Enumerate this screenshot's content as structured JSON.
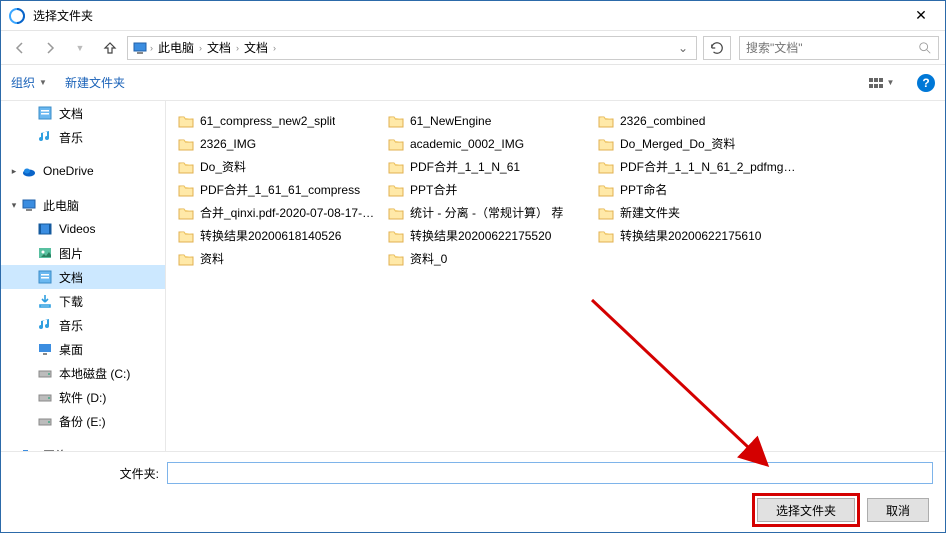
{
  "title": "选择文件夹",
  "breadcrumb": [
    "此电脑",
    "文档",
    "文档"
  ],
  "search_placeholder": "搜索\"文档\"",
  "toolbar": {
    "organize": "组织",
    "new_folder": "新建文件夹"
  },
  "tree": [
    {
      "label": "文档",
      "icon": "doc-lib",
      "indent": 1,
      "caret": ""
    },
    {
      "label": "音乐",
      "icon": "music",
      "indent": 1,
      "caret": ""
    },
    {
      "label": "OneDrive",
      "icon": "onedrive",
      "indent": 0,
      "caret": "▸"
    },
    {
      "label": "此电脑",
      "icon": "pc",
      "indent": 0,
      "caret": "▾"
    },
    {
      "label": "Videos",
      "icon": "video",
      "indent": 1,
      "caret": ""
    },
    {
      "label": "图片",
      "icon": "pictures",
      "indent": 1,
      "caret": ""
    },
    {
      "label": "文档",
      "icon": "doc-lib",
      "indent": 1,
      "caret": "",
      "selected": true
    },
    {
      "label": "下载",
      "icon": "download",
      "indent": 1,
      "caret": ""
    },
    {
      "label": "音乐",
      "icon": "music",
      "indent": 1,
      "caret": ""
    },
    {
      "label": "桌面",
      "icon": "desktop",
      "indent": 1,
      "caret": ""
    },
    {
      "label": "本地磁盘 (C:)",
      "icon": "drive",
      "indent": 1,
      "caret": ""
    },
    {
      "label": "软件 (D:)",
      "icon": "drive",
      "indent": 1,
      "caret": ""
    },
    {
      "label": "备份 (E:)",
      "icon": "drive",
      "indent": 1,
      "caret": ""
    },
    {
      "label": "网络",
      "icon": "network",
      "indent": 0,
      "caret": "▸"
    }
  ],
  "columns": [
    [
      "61_compress_new2_split",
      "2326_IMG",
      "Do_资料",
      "PDF合并_1_61_61_compress",
      "合并_qinxi.pdf-2020-07-08-17-43-...",
      "转换结果20200618140526",
      "资料"
    ],
    [
      "61_NewEngine",
      "academic_0002_IMG",
      "PDF合并_1_1_N_61",
      "PPT合并",
      "统计 - 分离 -（常规计算） 荐",
      "转换结果20200622175520",
      "资料_0"
    ],
    [
      "2326_combined",
      "Do_Merged_Do_资料",
      "PDF合并_1_1_N_61_2_pdfmge2_sp...",
      "PPT命名",
      "新建文件夹",
      "转换结果20200622175610"
    ]
  ],
  "folder_label": "文件夹:",
  "folder_input_value": "",
  "buttons": {
    "select": "选择文件夹",
    "cancel": "取消"
  }
}
